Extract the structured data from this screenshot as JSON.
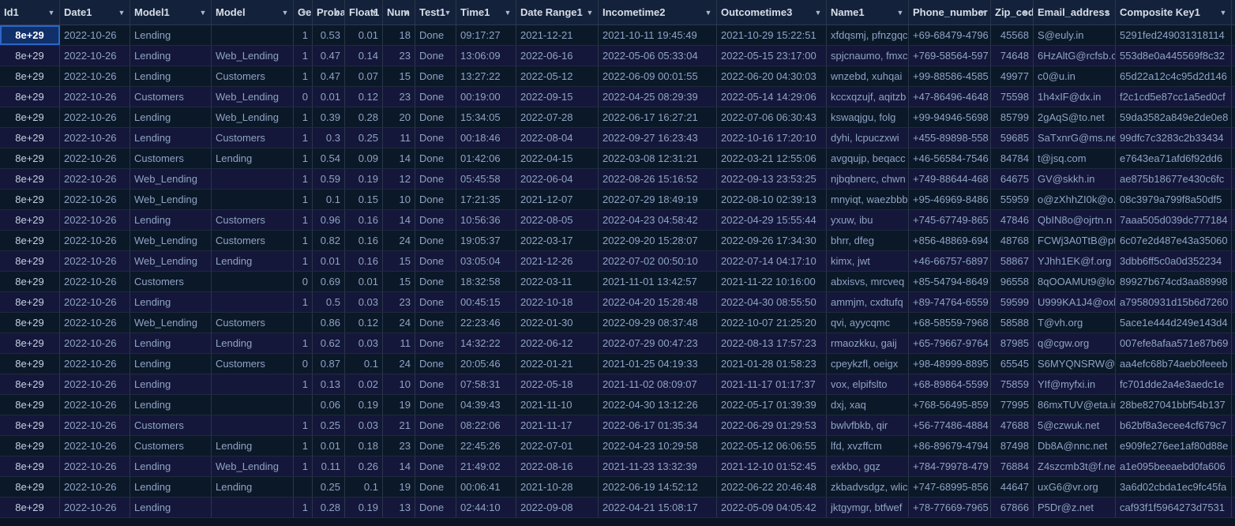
{
  "grid": {
    "columns": [
      {
        "label": "Id1"
      },
      {
        "label": "Date1"
      },
      {
        "label": "Model1"
      },
      {
        "label": "Model"
      },
      {
        "label": "Ge"
      },
      {
        "label": "Proba"
      },
      {
        "label": "Float1"
      },
      {
        "label": "Num"
      },
      {
        "label": "Test1"
      },
      {
        "label": "Time1"
      },
      {
        "label": "Date Range1"
      },
      {
        "label": "Incometime2"
      },
      {
        "label": "Outcometime3"
      },
      {
        "label": "Name1"
      },
      {
        "label": "Phone_number"
      },
      {
        "label": "Zip_cod"
      },
      {
        "label": "Email_address"
      },
      {
        "label": "Composite Key1"
      }
    ],
    "rows": [
      [
        "8e+29",
        "2022-10-26",
        "Lending",
        "",
        "1",
        "0.53",
        "0.01",
        "18",
        "Done",
        "09:17:27",
        "2021-12-21",
        "2021-10-11 19:45:49",
        "2021-10-29 15:22:51",
        "xfdqsmj, pfnzgqc",
        "+69-68479-4796",
        "45568",
        "S@euly.in",
        "5291fed249031318114"
      ],
      [
        "8e+29",
        "2022-10-26",
        "Lending",
        "Web_Lending",
        "1",
        "0.47",
        "0.14",
        "23",
        "Done",
        "13:06:09",
        "2022-06-16",
        "2022-05-06 05:33:04",
        "2022-05-15 23:17:00",
        "spjcnaumo, fmxc",
        "+769-58564-597",
        "74648",
        "6HzAltG@rcfsb.c",
        "553d8e0a445569f8c32"
      ],
      [
        "8e+29",
        "2022-10-26",
        "Lending",
        "Customers",
        "1",
        "0.47",
        "0.07",
        "15",
        "Done",
        "13:27:22",
        "2022-05-12",
        "2022-06-09 00:01:55",
        "2022-06-20 04:30:03",
        "wnzebd, xuhqai",
        "+99-88586-4585",
        "49977",
        "c0@u.in",
        "65d22a12c4c95d2d146"
      ],
      [
        "8e+29",
        "2022-10-26",
        "Customers",
        "Web_Lending",
        "0",
        "0.01",
        "0.12",
        "23",
        "Done",
        "00:19:00",
        "2022-09-15",
        "2022-04-25 08:29:39",
        "2022-05-14 14:29:06",
        "kccxqzujf, aqitzb",
        "+47-86496-4648",
        "75598",
        "1h4xIF@dx.in",
        "f2c1cd5e87cc1a5ed0cf"
      ],
      [
        "8e+29",
        "2022-10-26",
        "Lending",
        "Web_Lending",
        "1",
        "0.39",
        "0.28",
        "20",
        "Done",
        "15:34:05",
        "2022-07-28",
        "2022-06-17 16:27:21",
        "2022-07-06 06:30:43",
        "kswaqjgu, folg",
        "+99-94946-5698",
        "85799",
        "2gAqS@to.net",
        "59da3582a849e2de0e8"
      ],
      [
        "8e+29",
        "2022-10-26",
        "Lending",
        "Customers",
        "1",
        "0.3",
        "0.25",
        "11",
        "Done",
        "00:18:46",
        "2022-08-04",
        "2022-09-27 16:23:43",
        "2022-10-16 17:20:10",
        "dyhi, lcpuczxwi",
        "+455-89898-558",
        "59685",
        "SaTxnrG@ms.ne",
        "99dfc7c3283c2b33434"
      ],
      [
        "8e+29",
        "2022-10-26",
        "Customers",
        "Lending",
        "1",
        "0.54",
        "0.09",
        "14",
        "Done",
        "01:42:06",
        "2022-04-15",
        "2022-03-08 12:31:21",
        "2022-03-21 12:55:06",
        "avgqujp, beqacc",
        "+46-56584-7546",
        "84784",
        "t@jsq.com",
        "e7643ea71afd6f92dd6"
      ],
      [
        "8e+29",
        "2022-10-26",
        "Web_Lending",
        "",
        "1",
        "0.59",
        "0.19",
        "12",
        "Done",
        "05:45:58",
        "2022-06-04",
        "2022-08-26 15:16:52",
        "2022-09-13 23:53:25",
        "njbqbnerc, chwn",
        "+749-88644-468",
        "64675",
        "GV@skkh.in",
        "ae875b18677e430c6fc"
      ],
      [
        "8e+29",
        "2022-10-26",
        "Web_Lending",
        "",
        "1",
        "0.1",
        "0.15",
        "10",
        "Done",
        "17:21:35",
        "2021-12-07",
        "2022-07-29 18:49:19",
        "2022-08-10 02:39:13",
        "mnyiqt, waezbbb",
        "+95-46969-8486",
        "55959",
        "o@zXhhZI0k@o.c",
        "08c3979a799f8a50df5"
      ],
      [
        "8e+29",
        "2022-10-26",
        "Lending",
        "Customers",
        "1",
        "0.96",
        "0.16",
        "14",
        "Done",
        "10:56:36",
        "2022-08-05",
        "2022-04-23 04:58:42",
        "2022-04-29 15:55:44",
        "yxuw, ibu",
        "+745-67749-865",
        "47846",
        "QbIN8o@ojrtn.n",
        "7aaa505d039dc777184"
      ],
      [
        "8e+29",
        "2022-10-26",
        "Web_Lending",
        "Customers",
        "1",
        "0.82",
        "0.16",
        "24",
        "Done",
        "19:05:37",
        "2022-03-17",
        "2022-09-20 15:28:07",
        "2022-09-26 17:34:30",
        "bhrr, dfeg",
        "+856-48869-694",
        "48768",
        "FCWj3A0TtB@pt",
        "6c07e2d487e43a35060"
      ],
      [
        "8e+29",
        "2022-10-26",
        "Web_Lending",
        "Lending",
        "1",
        "0.01",
        "0.16",
        "15",
        "Done",
        "03:05:04",
        "2021-12-26",
        "2022-07-02 00:50:10",
        "2022-07-14 04:17:10",
        "kimx, jwt",
        "+46-66757-6897",
        "58867",
        "YJhh1EK@f.org",
        "3dbb6ff5c0a0d352234"
      ],
      [
        "8e+29",
        "2022-10-26",
        "Customers",
        "",
        "0",
        "0.69",
        "0.01",
        "15",
        "Done",
        "18:32:58",
        "2022-03-11",
        "2021-11-01 13:42:57",
        "2021-11-22 10:16:00",
        "abxisvs, mrcveq",
        "+85-54794-8649",
        "96558",
        "8qOOAMUt9@lo",
        "89927b674cd3aa88998"
      ],
      [
        "8e+29",
        "2022-10-26",
        "Lending",
        "",
        "1",
        "0.5",
        "0.03",
        "23",
        "Done",
        "00:45:15",
        "2022-10-18",
        "2022-04-20 15:28:48",
        "2022-04-30 08:55:50",
        "ammjm, cxdtufq",
        "+89-74764-6559",
        "59599",
        "U999KA1J4@oxl",
        "a79580931d15b6d7260"
      ],
      [
        "8e+29",
        "2022-10-26",
        "Web_Lending",
        "Customers",
        "",
        "0.86",
        "0.12",
        "24",
        "Done",
        "22:23:46",
        "2022-01-30",
        "2022-09-29 08:37:48",
        "2022-10-07 21:25:20",
        "qvi, ayycqmc",
        "+68-58559-7968",
        "58588",
        "T@vh.org",
        "5ace1e444d249e143d4"
      ],
      [
        "8e+29",
        "2022-10-26",
        "Lending",
        "Lending",
        "1",
        "0.62",
        "0.03",
        "11",
        "Done",
        "14:32:22",
        "2022-06-12",
        "2022-07-29 00:47:23",
        "2022-08-13 17:57:23",
        "rmaozkku, gaij",
        "+65-79667-9764",
        "87985",
        "q@cgw.org",
        "007efe8afaa571e87b69"
      ],
      [
        "8e+29",
        "2022-10-26",
        "Lending",
        "Customers",
        "0",
        "0.87",
        "0.1",
        "24",
        "Done",
        "20:05:46",
        "2022-01-21",
        "2021-01-25 04:19:33",
        "2021-01-28 01:58:23",
        "cpeykzfl, oeigx",
        "+98-48999-8895",
        "65545",
        "S6MYQNSRW@",
        "aa4efc68b74aeb0feeeb"
      ],
      [
        "8e+29",
        "2022-10-26",
        "Lending",
        "",
        "1",
        "0.13",
        "0.02",
        "10",
        "Done",
        "07:58:31",
        "2022-05-18",
        "2021-11-02 08:09:07",
        "2021-11-17 01:17:37",
        "vox, elpifslto",
        "+68-89864-5599",
        "75859",
        "YIf@myfxi.in",
        "fc701dde2a4e3aedc1e"
      ],
      [
        "8e+29",
        "2022-10-26",
        "Lending",
        "",
        "",
        "0.06",
        "0.19",
        "19",
        "Done",
        "04:39:43",
        "2021-11-10",
        "2022-04-30 13:12:26",
        "2022-05-17 01:39:39",
        "dxj, xaq",
        "+768-56495-859",
        "77995",
        "86mxTUV@eta.in",
        "28be827041bbf54b137"
      ],
      [
        "8e+29",
        "2022-10-26",
        "Customers",
        "",
        "1",
        "0.25",
        "0.03",
        "21",
        "Done",
        "08:22:06",
        "2021-11-17",
        "2022-06-17 01:35:34",
        "2022-06-29 01:29:53",
        "bwlvfbkb, qir",
        "+56-77486-4884",
        "47688",
        "5@czwuk.net",
        "b62bf8a3ecee4cf679c7"
      ],
      [
        "8e+29",
        "2022-10-26",
        "Customers",
        "Lending",
        "1",
        "0.01",
        "0.18",
        "23",
        "Done",
        "22:45:26",
        "2022-07-01",
        "2022-04-23 10:29:58",
        "2022-05-12 06:06:55",
        "lfd, xvzffcm",
        "+86-89679-4794",
        "87498",
        "Db8A@nnc.net",
        "e909fe276ee1af80d88e"
      ],
      [
        "8e+29",
        "2022-10-26",
        "Lending",
        "Web_Lending",
        "1",
        "0.11",
        "0.26",
        "14",
        "Done",
        "21:49:02",
        "2022-08-16",
        "2021-11-23 13:32:39",
        "2021-12-10 01:52:45",
        "exkbo, gqz",
        "+784-79978-479",
        "76884",
        "Z4szcmb3t@f.ne",
        "a1e095beeaebd0fa606"
      ],
      [
        "8e+29",
        "2022-10-26",
        "Lending",
        "Lending",
        "",
        "0.25",
        "0.1",
        "19",
        "Done",
        "00:06:41",
        "2021-10-28",
        "2022-06-19 14:52:12",
        "2022-06-22 20:46:48",
        "zkbadvsdgz, wlic",
        "+747-68995-856",
        "44647",
        "uxG6@vr.org",
        "3a6d02cbda1ec9fc45fa"
      ],
      [
        "8e+29",
        "2022-10-26",
        "Lending",
        "",
        "1",
        "0.28",
        "0.19",
        "13",
        "Done",
        "02:44:10",
        "2022-09-08",
        "2022-04-21 15:08:17",
        "2022-05-09 04:05:42",
        "jktgymgr, btfwef",
        "+78-77669-7965",
        "67866",
        "P5Dr@z.net",
        "caf93f1f5964273d7531"
      ]
    ]
  }
}
